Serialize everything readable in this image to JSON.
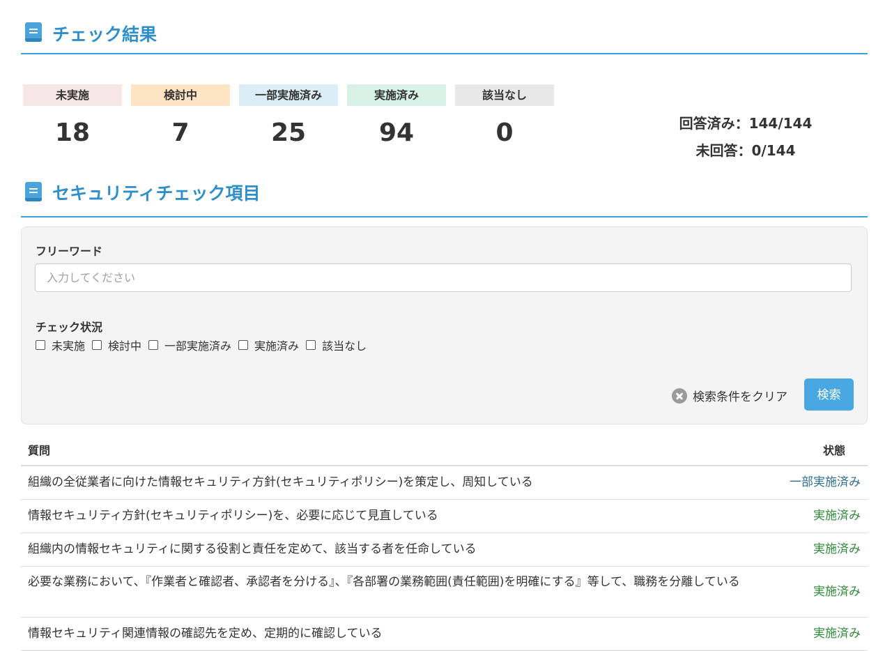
{
  "result_section": {
    "title": "チェック結果",
    "icon": "book-icon"
  },
  "stats": [
    {
      "label": "未実施",
      "value": "18",
      "color": "#f6e6e6"
    },
    {
      "label": "検討中",
      "value": "7",
      "color": "#fde5c4"
    },
    {
      "label": "一部実施済み",
      "value": "25",
      "color": "#dbeef5"
    },
    {
      "label": "実施済み",
      "value": "94",
      "color": "#d9f2e8"
    },
    {
      "label": "該当なし",
      "value": "0",
      "color": "#e8e8e8"
    }
  ],
  "answered": {
    "done": "回答済み：144/144",
    "remaining": "未回答：0/144"
  },
  "items_section": {
    "title": "セキュリティチェック項目",
    "icon": "book-icon"
  },
  "search": {
    "freeword_label": "フリーワード",
    "freeword_placeholder": "入力してください",
    "status_label": "チェック状況",
    "status_options": [
      "未実施",
      "検討中",
      "一部実施済み",
      "実施済み",
      "該当なし"
    ],
    "clear_label": "検索条件をクリア",
    "search_button": "検索"
  },
  "table": {
    "headers": {
      "question": "質問",
      "status": "状態"
    },
    "rows": [
      {
        "question": "組織の全従業者に向けた情報セキュリティ方針(セキュリティポリシー)を策定し、周知している",
        "status": "一部実施済み",
        "status_color": "#2e6f8e"
      },
      {
        "question": "情報セキュリティ方針(セキュリティポリシー)を、必要に応じて見直している",
        "status": "実施済み",
        "status_color": "#2e8b3a"
      },
      {
        "question": "組織内の情報セキュリティに関する役割と責任を定めて、該当する者を任命している",
        "status": "実施済み",
        "status_color": "#2e8b3a"
      },
      {
        "question": "必要な業務において、『作業者と確認者、承認者を分ける』、『各部署の業務範囲(責任範囲)を明確にする』等して、職務を分離している",
        "status": "実施済み",
        "status_color": "#2e8b3a"
      },
      {
        "question": "情報セキュリティ関連情報の確認先を定め、定期的に確認している",
        "status": "実施済み",
        "status_color": "#2e8b3a"
      }
    ]
  }
}
